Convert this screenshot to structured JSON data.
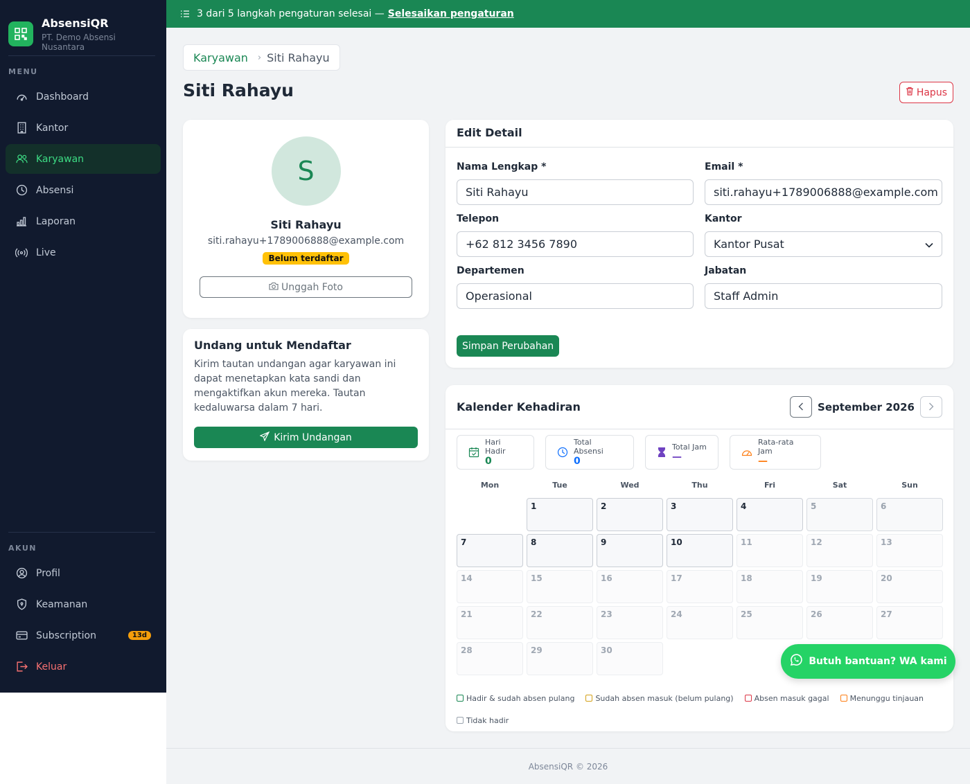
{
  "app": {
    "name": "AbsensiQR",
    "org": "PT. Demo Absensi Nusantara"
  },
  "sidebar": {
    "menu_title": "MENU",
    "menu": [
      {
        "label": "Dashboard",
        "icon": "gauge-icon"
      },
      {
        "label": "Kantor",
        "icon": "building-icon"
      },
      {
        "label": "Karyawan",
        "icon": "users-icon",
        "active": true
      },
      {
        "label": "Absensi",
        "icon": "clock-icon"
      },
      {
        "label": "Laporan",
        "icon": "bar-chart-icon"
      },
      {
        "label": "Live",
        "icon": "broadcast-icon"
      }
    ],
    "account_title": "AKUN",
    "account": [
      {
        "label": "Profil",
        "icon": "user-circle-icon"
      },
      {
        "label": "Keamanan",
        "icon": "shield-icon"
      },
      {
        "label": "Subscription",
        "icon": "credit-card-icon",
        "badge": "13d"
      },
      {
        "label": "Keluar",
        "icon": "logout-icon"
      }
    ]
  },
  "banner": {
    "text": "3 dari 5 langkah pengaturan selesai —",
    "link": "Selesaikan pengaturan"
  },
  "breadcrumb": {
    "parent": "Karyawan",
    "sep": "›",
    "current": "Siti Rahayu"
  },
  "page": {
    "title": "Siti Rahayu",
    "delete_label": "Hapus"
  },
  "profile": {
    "initial": "S",
    "name": "Siti Rahayu",
    "email": "siti.rahayu+1789006888@example.com",
    "status": "Belum terdaftar",
    "upload_label": "Unggah Foto"
  },
  "invite": {
    "title": "Undang untuk Mendaftar",
    "text": "Kirim tautan undangan agar karyawan ini dapat menetapkan kata sandi dan mengaktifkan akun mereka. Tautan kedaluwarsa dalam 7 hari.",
    "button": "Kirim Undangan"
  },
  "edit": {
    "title": "Edit Detail",
    "fields": {
      "name": {
        "label": "Nama Lengkap *",
        "value": "Siti Rahayu"
      },
      "email": {
        "label": "Email *",
        "value": "siti.rahayu+1789006888@example.com"
      },
      "phone": {
        "label": "Telepon",
        "value": "+62 812 3456 7890"
      },
      "office": {
        "label": "Kantor",
        "value": "Kantor Pusat"
      },
      "department": {
        "label": "Departemen",
        "value": "Operasional"
      },
      "position": {
        "label": "Jabatan",
        "value": "Staff Admin"
      }
    },
    "save_label": "Simpan Perubahan"
  },
  "calendar": {
    "title": "Kalender Kehadiran",
    "month": "September 2026",
    "stats": [
      {
        "label": "Hari Hadir",
        "value": "0",
        "color": "#198754",
        "icon": "calendar-check-icon"
      },
      {
        "label": "Total Absensi",
        "value": "0",
        "color": "#0d6efd",
        "icon": "clock-icon"
      },
      {
        "label": "Total Jam",
        "value": "—",
        "color": "#6f42c1",
        "icon": "hourglass-icon"
      },
      {
        "label": "Rata-rata Jam",
        "value": "—",
        "color": "#fd7e14",
        "icon": "speedometer-icon"
      }
    ],
    "weekdays": [
      "Mon",
      "Tue",
      "Wed",
      "Thu",
      "Fri",
      "Sat",
      "Sun"
    ],
    "days": [
      {
        "d": "",
        "t": "blank"
      },
      {
        "d": "1",
        "t": "past"
      },
      {
        "d": "2",
        "t": "past"
      },
      {
        "d": "3",
        "t": "past"
      },
      {
        "d": "4",
        "t": "past"
      },
      {
        "d": "5",
        "t": "weekend"
      },
      {
        "d": "6",
        "t": "weekend"
      },
      {
        "d": "7",
        "t": "past"
      },
      {
        "d": "8",
        "t": "past"
      },
      {
        "d": "9",
        "t": "past"
      },
      {
        "d": "10",
        "t": "past"
      },
      {
        "d": "11",
        "t": "future"
      },
      {
        "d": "12",
        "t": "future"
      },
      {
        "d": "13",
        "t": "future"
      },
      {
        "d": "14",
        "t": "future"
      },
      {
        "d": "15",
        "t": "future"
      },
      {
        "d": "16",
        "t": "future"
      },
      {
        "d": "17",
        "t": "future"
      },
      {
        "d": "18",
        "t": "future"
      },
      {
        "d": "19",
        "t": "future"
      },
      {
        "d": "20",
        "t": "future"
      },
      {
        "d": "21",
        "t": "future"
      },
      {
        "d": "22",
        "t": "future"
      },
      {
        "d": "23",
        "t": "future"
      },
      {
        "d": "24",
        "t": "future"
      },
      {
        "d": "25",
        "t": "future"
      },
      {
        "d": "26",
        "t": "future"
      },
      {
        "d": "27",
        "t": "future"
      },
      {
        "d": "28",
        "t": "future"
      },
      {
        "d": "29",
        "t": "future"
      },
      {
        "d": "30",
        "t": "future"
      }
    ],
    "legend": [
      {
        "label": "Hadir & sudah absen pulang",
        "color": "#198754"
      },
      {
        "label": "Sudah absen masuk (belum pulang)",
        "color": "#d4a017"
      },
      {
        "label": "Absen masuk gagal",
        "color": "#dc3545"
      },
      {
        "label": "Menunggu tinjauan",
        "color": "#fd7e14"
      },
      {
        "label": "Tidak hadir",
        "color": "#9aa3ae"
      }
    ]
  },
  "wa": {
    "label": "Butuh bantuan? WA kami"
  },
  "footer": {
    "text": "AbsensiQR © 2026"
  }
}
